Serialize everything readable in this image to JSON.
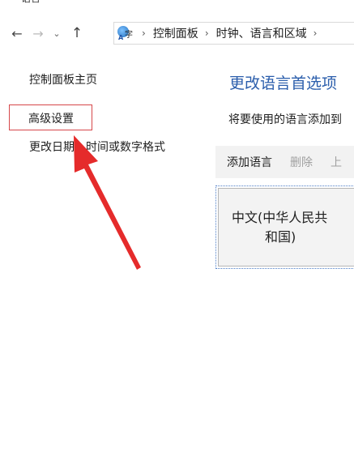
{
  "window": {
    "title": "语言"
  },
  "nav": {
    "breadcrumbs": [
      "控制面板",
      "时钟、语言和区域"
    ]
  },
  "sidebar": {
    "home": "控制面板主页",
    "advanced": "高级设置",
    "change_date": "更改日期、时间或数字格式"
  },
  "main": {
    "title": "更改语言首选项",
    "description": "将要使用的语言添加到",
    "toolbar": {
      "add": "添加语言",
      "remove": "删除",
      "up": "上"
    },
    "languages": [
      {
        "line1": "中文(中华人民共",
        "line2": "和国)"
      }
    ]
  },
  "annotation": {
    "arrow_color": "#e52b2b",
    "box_color": "#d6474a"
  }
}
